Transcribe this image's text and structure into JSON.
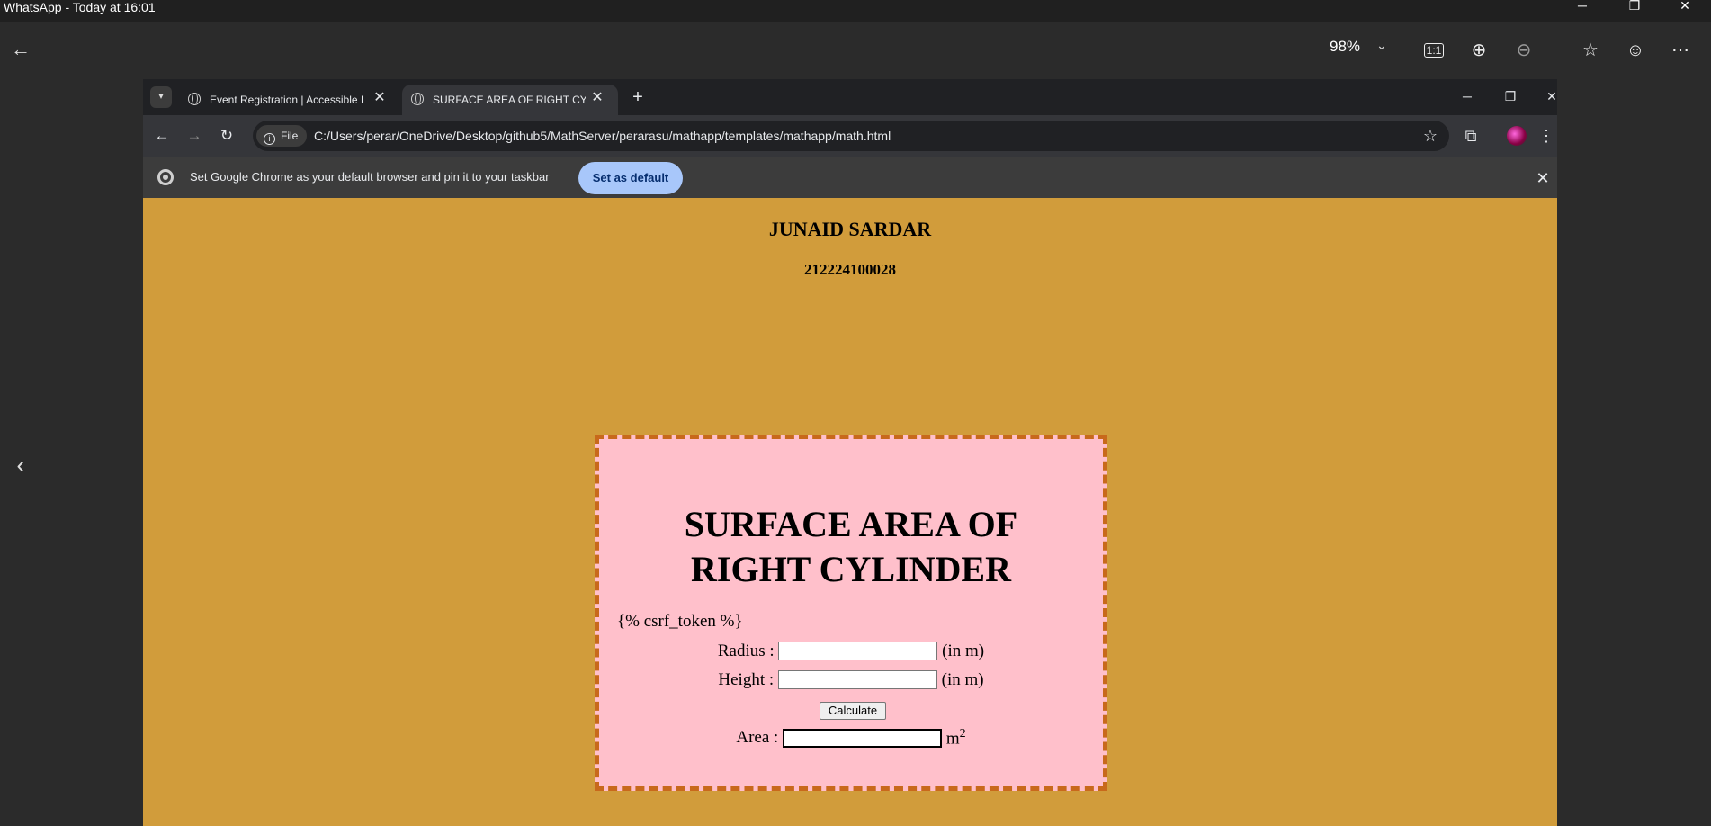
{
  "viewer": {
    "title": "WhatsApp - Today at 16:01",
    "zoom": "98%"
  },
  "browser": {
    "tabs": [
      {
        "label": "Event Registration | Accessible I"
      },
      {
        "label": "SURFACE AREA OF RIGHT CYLIN"
      }
    ],
    "address": {
      "chip": "File",
      "url": "C:/Users/perar/OneDrive/Desktop/github5/MathServer/perarasu/mathapp/templates/mathapp/math.html"
    },
    "infobar": {
      "message": "Set Google Chrome as your default browser and pin it to your taskbar",
      "button": "Set as default"
    }
  },
  "page": {
    "name": "JUNAID SARDAR",
    "regno": "212224100028",
    "heading": "SURFACE AREA OF RIGHT CYLINDER",
    "csrf": "{% csrf_token %}",
    "radius_label": "Radius :",
    "height_label": "Height :",
    "unit": "(in m)",
    "calculate": "Calculate",
    "area_label": "Area :",
    "area_unit": "m",
    "area_exp": "2",
    "radius_value": "",
    "height_value": "",
    "area_value": ""
  }
}
